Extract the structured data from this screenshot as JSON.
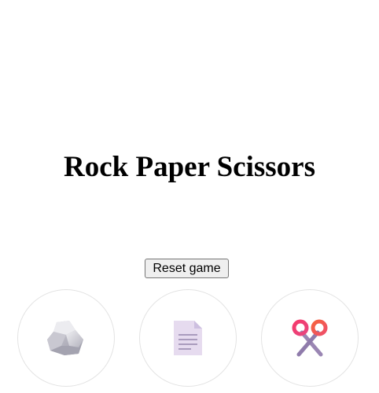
{
  "game": {
    "title": "Rock Paper Scissors",
    "reset_label": "Reset game"
  },
  "choices": [
    {
      "id": "rock",
      "icon": "rock-icon"
    },
    {
      "id": "paper",
      "icon": "paper-icon"
    },
    {
      "id": "scissors",
      "icon": "scissors-icon"
    }
  ],
  "colors": {
    "background": "#ffffff",
    "circle_border": "#e3e3e3",
    "rock": "#b9b8c2",
    "paper": "#e6dbef",
    "scissors_handles": "#f0446a",
    "scissors_blades": "#9a86b3"
  }
}
